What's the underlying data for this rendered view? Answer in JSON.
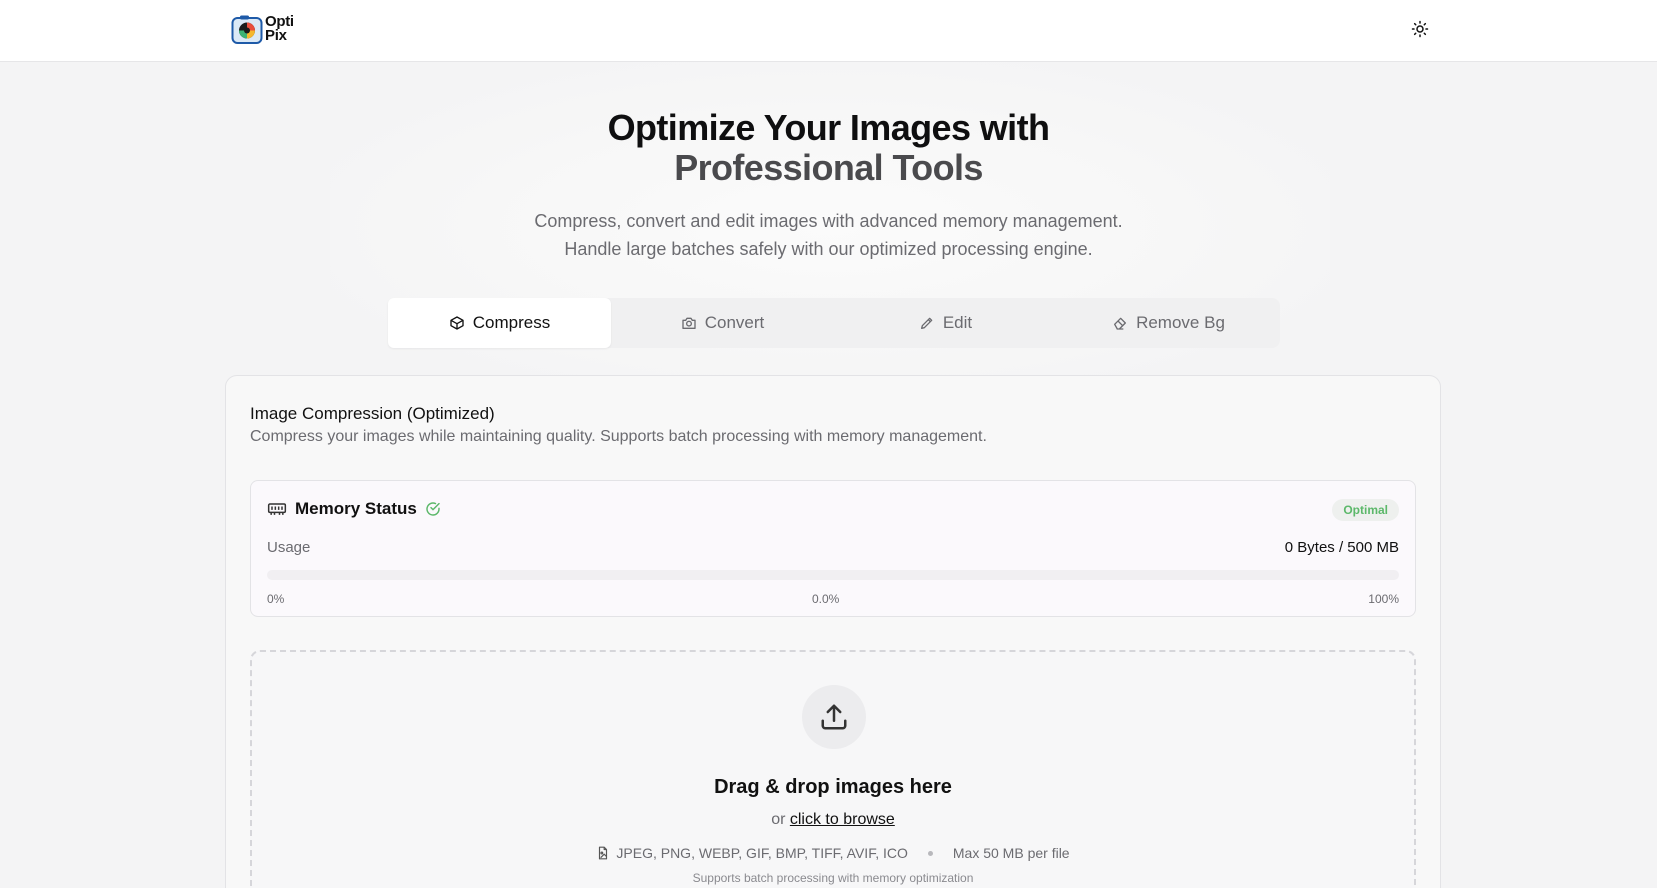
{
  "brand": {
    "name_line1": "Opti",
    "name_line2": "Pix"
  },
  "header": {
    "theme_toggle": "sun-icon"
  },
  "hero": {
    "title_line1": "Optimize Your Images with",
    "title_line2": "Professional Tools",
    "subtitle_line1": "Compress, convert and edit images with advanced memory management.",
    "subtitle_line2": "Handle large batches safely with our optimized processing engine."
  },
  "tabs": [
    {
      "label": "Compress",
      "icon": "box-icon",
      "active": true
    },
    {
      "label": "Convert",
      "icon": "camera-icon",
      "active": false
    },
    {
      "label": "Edit",
      "icon": "pencil-icon",
      "active": false
    },
    {
      "label": "Remove Bg",
      "icon": "eraser-icon",
      "active": false
    }
  ],
  "compression": {
    "title": "Image Compression (Optimized)",
    "description": "Compress your images while maintaining quality. Supports batch processing with memory management."
  },
  "memory": {
    "title": "Memory Status",
    "badge": "Optimal",
    "usage_label": "Usage",
    "usage_value": "0 Bytes / 500 MB",
    "usage_percent": 0,
    "tick_min": "0%",
    "tick_current": "0.0%",
    "tick_max": "100%"
  },
  "dropzone": {
    "title": "Drag & drop images here",
    "or_text": "or",
    "browse_link": "click to browse",
    "formats": "JPEG, PNG, WEBP, GIF, BMP, TIFF, AVIF, ICO",
    "max_size": "Max 50 MB per file",
    "note": "Supports batch processing with memory optimization"
  },
  "colors": {
    "accent": "#111111",
    "badge_green": "#5cb86a",
    "muted": "#6b6b70"
  }
}
